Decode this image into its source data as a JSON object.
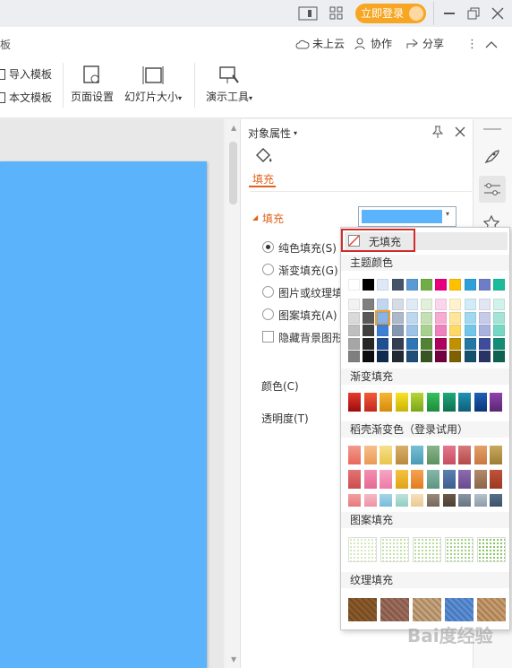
{
  "titlebar": {
    "window_icon": "layout-icon",
    "login_label": "立即登录"
  },
  "ribbon": {
    "partial_tab": "板",
    "cloud_label": "未上云",
    "collab_label": "协作",
    "share_label": "分享",
    "import_template": "导入模板",
    "this_template": "本文模板",
    "page_setup": "页面设置",
    "slide_size": "幻灯片大小",
    "present_tools": "演示工具"
  },
  "panel": {
    "title": "对象属性",
    "tab_fill": "填充",
    "fill_section": "填充",
    "options": [
      "纯色填充(S)",
      "渐变填充(G)",
      "图片或纹理填",
      "图案填充(A)"
    ],
    "hide_bg": "隐藏背景图形",
    "color_label": "颜色(C)",
    "transparency_label": "透明度(T)",
    "fill_color": "#5bb3fb"
  },
  "dropdown": {
    "no_fill": "无填充",
    "theme_colors": "主题颜色",
    "gradient_fill": "渐变填充",
    "docer_gradient": "稻壳渐变色（登录试用）",
    "pattern_fill": "图案填充",
    "texture_fill": "纹理填充"
  },
  "watermark": "Bai度经验",
  "colors": {
    "theme_row": [
      "#ffffff",
      "#000000",
      "#dfe8f6",
      "#44546a",
      "#5b9bd5",
      "#70ad47",
      "#e6007e",
      "#ffc000",
      "#2e9fd8",
      "#6f7dc8",
      "#1abc9c"
    ],
    "theme_cols": [
      [
        "#f2f2f2",
        "#d9d9d9",
        "#bfbfbf",
        "#a6a6a6",
        "#7f7f7f"
      ],
      [
        "#7f7f7f",
        "#595959",
        "#404040",
        "#262626",
        "#0d0d0d"
      ],
      [
        "#c2d6f0",
        "#8ab3e3",
        "#3f7fd4",
        "#1d4f91",
        "#0f2b4f"
      ],
      [
        "#d6dce5",
        "#adb9ca",
        "#8497b0",
        "#333f50",
        "#222a35"
      ],
      [
        "#deebf7",
        "#bdd7ee",
        "#9dc3e6",
        "#2e75b6",
        "#1f4e79"
      ],
      [
        "#e2f0d9",
        "#c5e0b4",
        "#a9d18e",
        "#548235",
        "#375623"
      ],
      [
        "#fbd5e9",
        "#f7abd3",
        "#f080bd",
        "#ad005e",
        "#73003f"
      ],
      [
        "#fff2cc",
        "#ffe699",
        "#ffd966",
        "#bf9000",
        "#7f6000"
      ],
      [
        "#d0ecf8",
        "#a1d9f1",
        "#72c6ea",
        "#2277a3",
        "#15506d"
      ],
      [
        "#e2e5f4",
        "#c5cbe9",
        "#a9b1de",
        "#3f4c9c",
        "#2a3368"
      ],
      [
        "#d1f2eb",
        "#a3e4d7",
        "#76d7c4",
        "#138d75",
        "#0e6251"
      ]
    ],
    "gradient_row": [
      [
        "#e63b2e",
        "#9b0c0c"
      ],
      [
        "#f25a3a",
        "#c1271d"
      ],
      [
        "#f7b733",
        "#d48a0c"
      ],
      [
        "#f9e227",
        "#c9b30a"
      ],
      [
        "#b6d637",
        "#7ba51d"
      ],
      [
        "#34c15f",
        "#1e8b3c"
      ],
      [
        "#1fa97a",
        "#0f6e4f"
      ],
      [
        "#2193b0",
        "#0f5e7a"
      ],
      [
        "#1d5fb8",
        "#0c3576"
      ],
      [
        "#8e44ad",
        "#5b2673"
      ]
    ],
    "docer_rows": [
      [
        [
          "#f29a8e",
          "#e9695a"
        ],
        [
          "#f6c08a",
          "#ea9a55"
        ],
        [
          "#f6e08a",
          "#e9c54c"
        ],
        [
          "#d9b06a",
          "#b98a3d"
        ],
        [
          "#76c0d6",
          "#4b9ab5"
        ],
        [
          "#89b58b",
          "#5d915f"
        ],
        [
          "#e3788c",
          "#c84d62"
        ],
        [
          "#d8797a",
          "#b4494b"
        ],
        [
          "#e5a06a",
          "#c87840"
        ],
        [
          "#c9a95d",
          "#9c7f32"
        ]
      ],
      [
        [
          "#e57373",
          "#c94f4f"
        ],
        [
          "#f48fb1",
          "#e46a92"
        ],
        [
          "#f7a6c4",
          "#ec7aa5"
        ],
        [
          "#f5c242",
          "#e0a417"
        ],
        [
          "#f6a354",
          "#e07c1f"
        ],
        [
          "#86b7a8",
          "#5d9482"
        ],
        [
          "#5b7fb0",
          "#3d5f8e"
        ],
        [
          "#8c6bb1",
          "#6a4b8e"
        ],
        [
          "#b08a6b",
          "#8c6647"
        ],
        [
          "#c0533a",
          "#9b3822"
        ]
      ],
      [
        [
          "#f4a0a0",
          "#e57a7a"
        ],
        [
          "#f7b9c5",
          "#ed93a4"
        ],
        [
          "#a4d4ea",
          "#78bcdc"
        ],
        [
          "#bfe3dc",
          "#90cdc2"
        ],
        [
          "#f6e0bc",
          "#ecc991"
        ],
        [
          "#9a8a7a",
          "#74665a"
        ],
        [
          "#6a5a4a",
          "#4d3f32"
        ],
        [
          "#8a96a4",
          "#667380"
        ],
        [
          "#b6c2cc",
          "#8e9ca8"
        ],
        [
          "#56708a",
          "#3b5268"
        ]
      ]
    ],
    "pattern_row": [
      "#c4e3a8",
      "#b0d98c",
      "#9fd078",
      "#7fc055",
      "#5fb030"
    ],
    "texture_row": [
      "#8a5a2b",
      "#9c6b5a",
      "#c6a27a",
      "#5a8fd8",
      "#c79a6b"
    ]
  }
}
